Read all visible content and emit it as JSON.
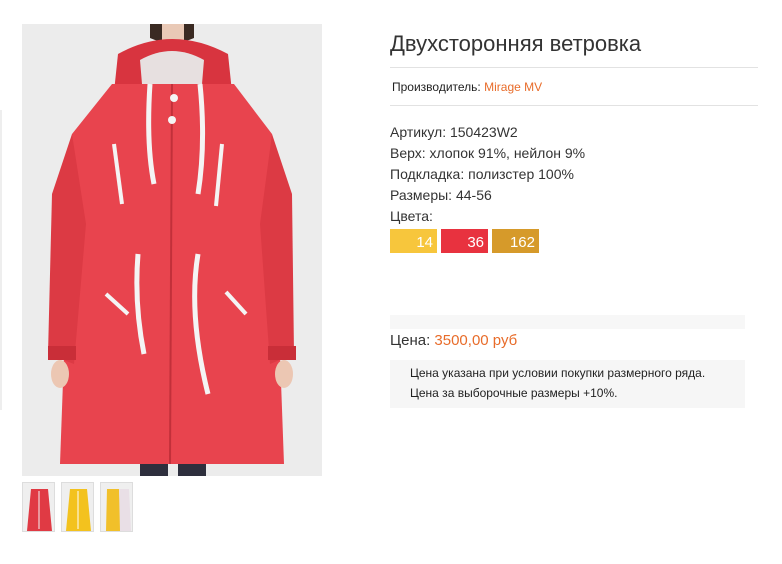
{
  "product": {
    "title": "Двухсторонняя ветровка",
    "manufacturer_label": "Производитель:",
    "manufacturer_name": "Mirage MV",
    "specs": [
      "Артикул: 150423W2",
      "Верх: хлопок 91%, нейлон 9%",
      "Подкладка: полизстер 100%",
      "Размеры: 44-56",
      "Цвета:"
    ],
    "colors": [
      {
        "code": "14",
        "hex": "#f7c63c"
      },
      {
        "code": "36",
        "hex": "#e8323f"
      },
      {
        "code": "162",
        "hex": "#d69a2a"
      }
    ],
    "price_label": "Цена:",
    "price_value": "3500,00 руб",
    "notes": [
      "Цена указана при условии покупки размерного ряда.",
      "Цена за выборочные размеры +10%."
    ]
  },
  "images": {
    "main_color": "#e8444e",
    "thumbnails": [
      {
        "name": "red",
        "color": "#e03a44"
      },
      {
        "name": "yellow",
        "color": "#f3c21e"
      },
      {
        "name": "yellow-alt",
        "color": "#f1c02a"
      }
    ]
  },
  "colors": {
    "accent": "#e86c2a",
    "text": "#333333"
  }
}
